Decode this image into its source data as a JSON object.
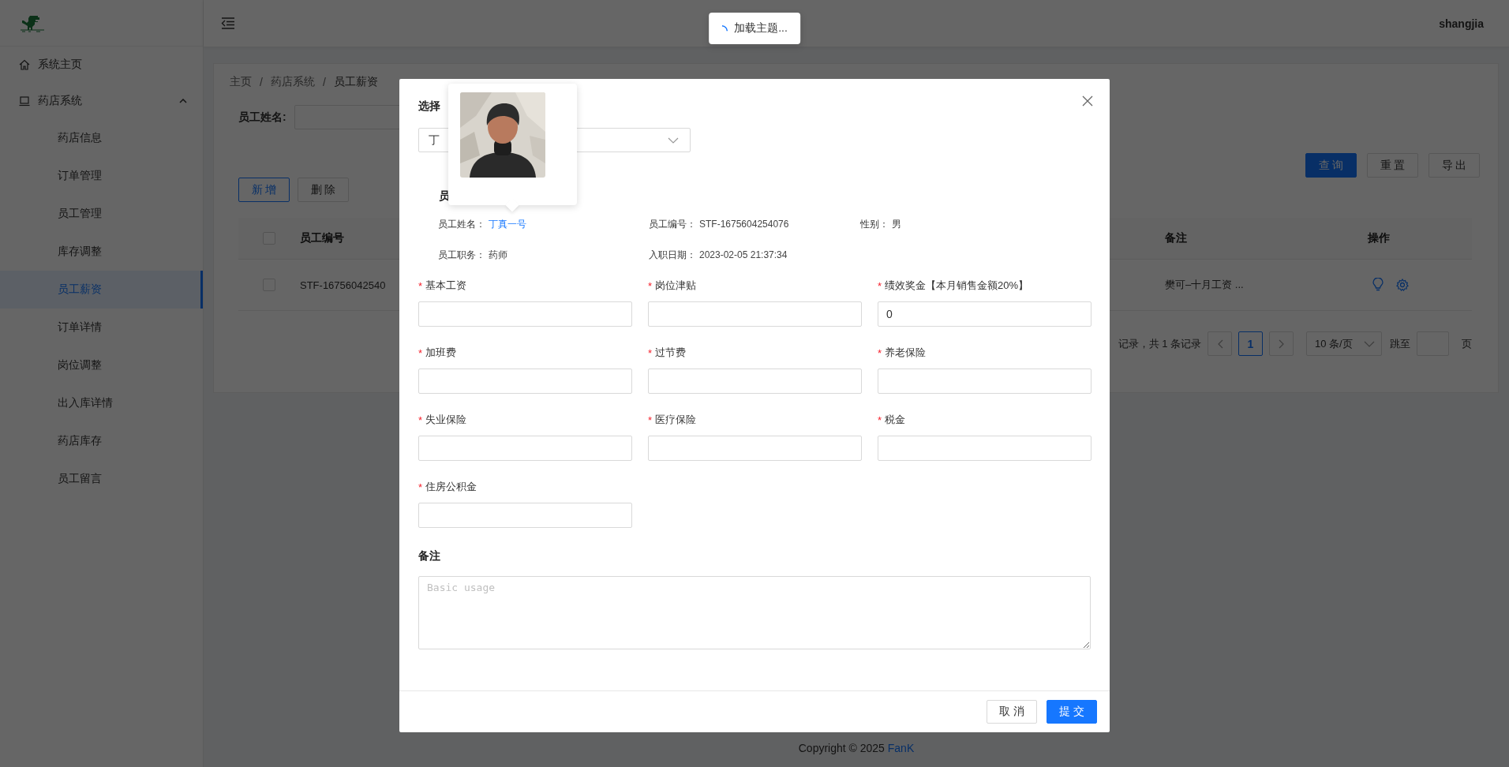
{
  "menu": [
    {
      "label": "系统主页",
      "kind": "home"
    },
    {
      "label": "药店系统",
      "kind": "group",
      "expanded": true,
      "children": [
        {
          "label": "药店信息",
          "selected": false
        },
        {
          "label": "订单管理",
          "selected": false
        },
        {
          "label": "员工管理",
          "selected": false
        },
        {
          "label": "库存调整",
          "selected": false
        },
        {
          "label": "员工薪资",
          "selected": true
        },
        {
          "label": "订单详情",
          "selected": false
        },
        {
          "label": "岗位调整",
          "selected": false
        },
        {
          "label": "出入库详情",
          "selected": false
        },
        {
          "label": "药店库存",
          "selected": false
        },
        {
          "label": "员工留言",
          "selected": false
        }
      ]
    }
  ],
  "header": {
    "user": "shangjia"
  },
  "toast": {
    "text": "加载主题..."
  },
  "breadcrumb": [
    "主页",
    "药店系统",
    "员工薪资"
  ],
  "breadcrumb_separators": [
    "/",
    "/"
  ],
  "filter": {
    "label": "员工姓名:"
  },
  "toolbar_buttons": [
    {
      "label": "查 询",
      "kind": "primary"
    },
    {
      "label": "重 置",
      "kind": "default"
    },
    {
      "label": "导 出",
      "kind": "default"
    }
  ],
  "action_buttons": [
    {
      "label": "新 增",
      "kind": "outline"
    },
    {
      "label": "删 除",
      "kind": "default"
    }
  ],
  "table": {
    "all_checked": false,
    "columns": [
      "员工编号",
      "备注",
      "操作"
    ],
    "rows": [
      {
        "checked": false,
        "id": "STF-16756042540",
        "remark": "樊可–十月工资 ..."
      }
    ]
  },
  "pagination": {
    "summary": "记录，共 1 条记录",
    "pages": [
      {
        "label": "1",
        "selected": true
      }
    ],
    "page_size": "10 条/页",
    "jump_label": "跳至",
    "page_suffix": "页"
  },
  "footer": {
    "text": "Copyright © 2025",
    "link": "FanK"
  },
  "modal": {
    "select_label": "选择",
    "select_value": "丁",
    "section_title": "员",
    "info": [
      {
        "label": "员工姓名：",
        "value": "丁真一号",
        "kind": "link"
      },
      {
        "label": "员工编号：",
        "value": "STF-1675604254076",
        "kind": "text"
      },
      {
        "label": "性别：",
        "value": "男",
        "kind": "text"
      },
      {
        "label": "员工职务：",
        "value": "药师",
        "kind": "text"
      },
      {
        "label": "入职日期：",
        "value": "2023-02-05 21:37:34",
        "kind": "text"
      }
    ],
    "fields": [
      {
        "label": "基本工资",
        "required": true,
        "marker": "*"
      },
      {
        "label": "岗位津贴",
        "required": true,
        "marker": "*"
      },
      {
        "label": "绩效奖金【本月销售金额20%】",
        "required": true,
        "marker": "*",
        "value": "0"
      },
      {
        "label": "加班费",
        "required": true,
        "marker": "*"
      },
      {
        "label": "过节费",
        "required": true,
        "marker": "*"
      },
      {
        "label": "养老保险",
        "required": true,
        "marker": "*"
      },
      {
        "label": "失业保险",
        "required": true,
        "marker": "*"
      },
      {
        "label": "医疗保险",
        "required": true,
        "marker": "*"
      },
      {
        "label": "税金",
        "required": true,
        "marker": "*"
      },
      {
        "label": "住房公积金",
        "required": true,
        "marker": "*"
      }
    ],
    "remark": {
      "label": "备注",
      "placeholder": "Basic usage"
    },
    "buttons": [
      {
        "label": "取 消",
        "kind": "default"
      },
      {
        "label": "提 交",
        "kind": "primary"
      }
    ]
  }
}
